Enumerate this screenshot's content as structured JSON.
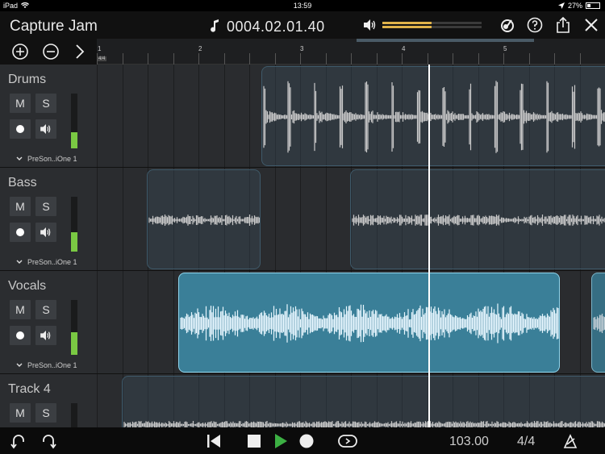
{
  "status_bar": {
    "device": "iPad",
    "time": "13:59",
    "battery": "27%",
    "battery_fraction": 0.27
  },
  "top_bar": {
    "title": "Capture Jam",
    "position": "0004.02.01.40",
    "volume_fraction": 0.5
  },
  "ruler": {
    "time_signature": "4/4",
    "bars": [
      "1",
      "2",
      "3",
      "4",
      "5"
    ]
  },
  "tracks": [
    {
      "name": "Drums",
      "mute_label": "M",
      "solo_label": "S",
      "instrument": "PreSon..iOne 1",
      "level": 0.3
    },
    {
      "name": "Bass",
      "mute_label": "M",
      "solo_label": "S",
      "instrument": "PreSon..iOne 1",
      "level": 0.35
    },
    {
      "name": "Vocals",
      "mute_label": "M",
      "solo_label": "S",
      "instrument": "PreSon..iOne 1",
      "level": 0.4
    },
    {
      "name": "Track 4",
      "mute_label": "M",
      "solo_label": "S"
    }
  ],
  "transport": {
    "tempo": "103.00",
    "meter": "4/4"
  },
  "colors": {
    "accent": "#7ac943",
    "volume": "#e0b24a",
    "selected_clip": "#3a7f98",
    "play": "#3cb043"
  }
}
